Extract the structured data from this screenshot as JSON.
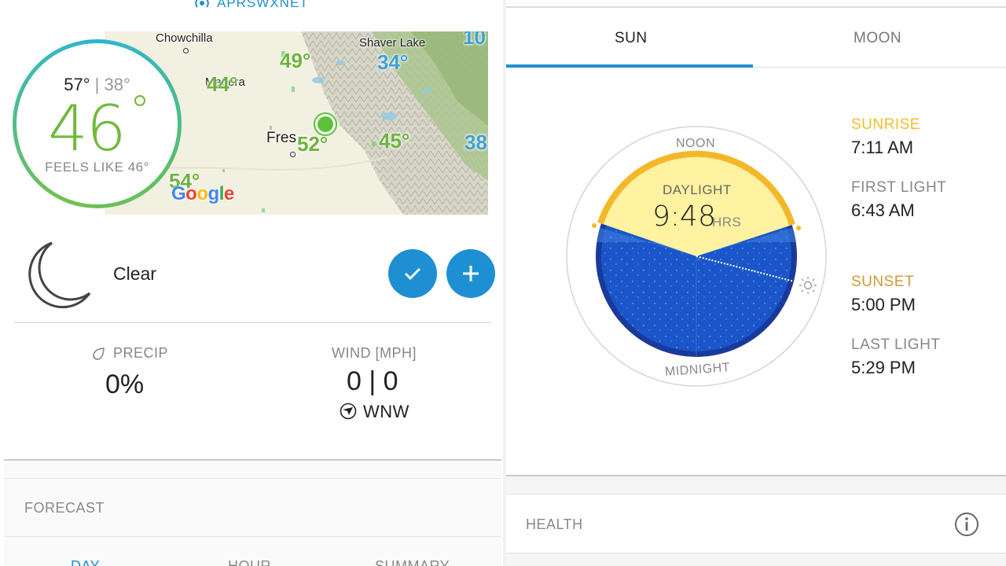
{
  "left": {
    "aprs_label": "APRSWXNET",
    "current": {
      "high": "57°",
      "separator": "|",
      "low": "38°",
      "temp": "46",
      "feels_like": "FEELS LIKE 46°",
      "condition": "Clear"
    },
    "map": {
      "cities": [
        "Chowchilla",
        "Madera",
        "Fres",
        "Shaver Lake"
      ],
      "temps": [
        "49°",
        "44°",
        "52°",
        "45°",
        "34°",
        "10",
        "38",
        "54°"
      ],
      "attribution": "Google"
    },
    "precip": {
      "label": "PRECIP",
      "value": "0%"
    },
    "wind": {
      "label": "WIND [MPH]",
      "value": "0 | 0",
      "direction": "WNW"
    },
    "forecast": {
      "title": "FORECAST",
      "tabs": [
        "DAY",
        "HOUR",
        "SUMMARY"
      ]
    }
  },
  "right": {
    "tabs": [
      "SUN",
      "MOON"
    ],
    "dial": {
      "noon": "NOON",
      "midnight": "MIDNIGHT",
      "daylight_label": "DAYLIGHT",
      "daylight_value": "9:48",
      "daylight_unit": "HRS"
    },
    "events": [
      {
        "label": "SUNRISE",
        "time": "7:11 AM"
      },
      {
        "label": "FIRST LIGHT",
        "time": "6:43 AM"
      },
      {
        "label": "SUNSET",
        "time": "5:00 PM"
      },
      {
        "label": "LAST LIGHT",
        "time": "5:29 PM"
      }
    ],
    "health": "HEALTH"
  },
  "colors": {
    "accent_blue": "#1e8fd2",
    "temp_green": "#6fba3a",
    "sunrise_gold": "#f0bd2b",
    "sunset_gold": "#d19a36",
    "night_blue": "#1a56c9"
  }
}
